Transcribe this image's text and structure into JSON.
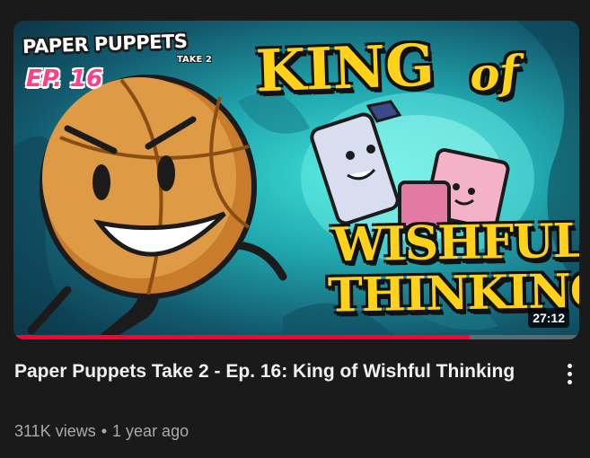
{
  "thumbnail": {
    "series_logo": "PAPER PUPPETS",
    "series_logo_sub": "TAKE 2",
    "episode_badge": "EP. 16",
    "art_title_line1": "KING",
    "art_title_line1b": "of",
    "art_title_line2": "WISHFUL",
    "art_title_line3": "THINKING",
    "duration": "27:12",
    "watch_progress": 0.807,
    "colors": {
      "progress": "#ff0033",
      "title_art": "#ffd21a",
      "episode": "#ff3f8a"
    }
  },
  "video": {
    "title": "Paper Puppets Take 2 - Ep. 16: King of Wishful Thinking",
    "views": "311K views",
    "separator": "•",
    "age": "1 year ago"
  },
  "menu": {
    "icon": "more-vert-icon"
  }
}
